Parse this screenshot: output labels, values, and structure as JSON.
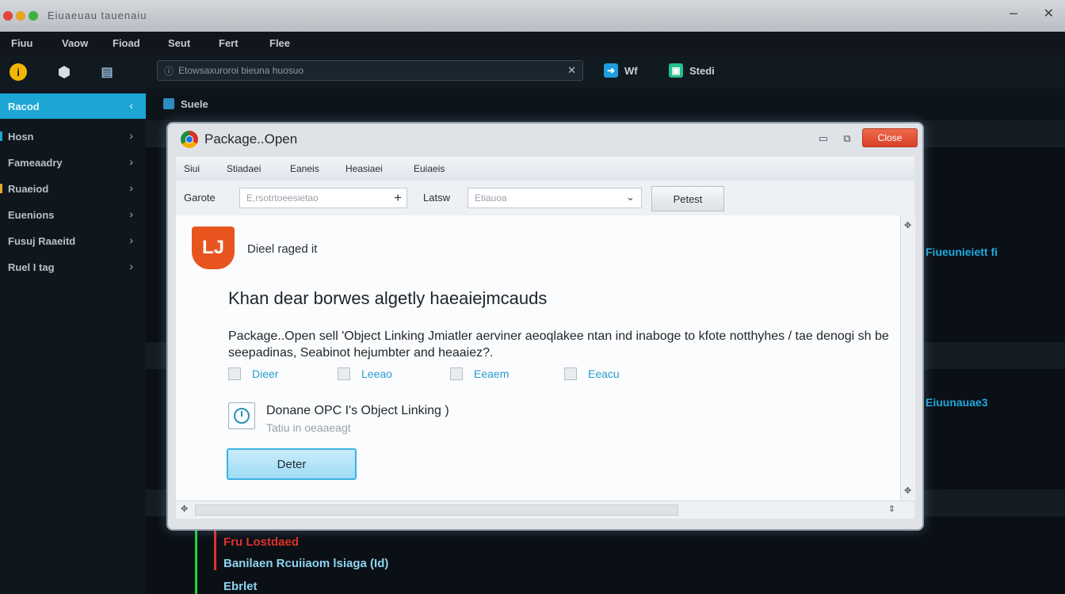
{
  "window": {
    "title": "Package..Open",
    "background_title": "Eiuaeuau tauenaiu",
    "close_label": "Close"
  },
  "background": {
    "menu": [
      "Fiuu",
      "Vaow",
      "Fioad",
      "Seut",
      "Fert",
      "Flee"
    ],
    "address": "Etowsaxuroroi bieuna huosuo",
    "toolbar_buttons": [
      "Wf",
      "Stedi"
    ],
    "content_header": "Suele",
    "sidebar": [
      "Racod",
      "Hosn",
      "Fameaadry",
      "Ruaeiod",
      "Euenions",
      "Fusuj Raaeitd",
      "Ruel I tag"
    ],
    "right_labels": [
      "Fiueunieiett fi",
      "Eiuunauae3"
    ],
    "tree": [
      "Fru Lostdaed",
      "Banilaen Rcuiiaom lsiaga (Id)",
      "Ebrlet"
    ]
  },
  "dialog": {
    "menu": [
      "Siui",
      "Stiadaei",
      "Eaneis",
      "Heasiaei",
      "Euiaeis"
    ],
    "search_label": "Garote",
    "search_placeholder": "E,rsotrtoeesietao",
    "view_label": "Latsw",
    "view_value": "Etiauoa",
    "action_button": "Petest",
    "package_name": "Dieel raged it",
    "heading": "Khan dear borwes algetly haeaiejmcauds",
    "paragraph": "Package..Open sell 'Object Linking Jmiatler aerviner aeoqlakee ntan ind inaboge to kfote notthyhes / tae denogi sh be seepadinas, Seabinot hejumbter and heaaiez?.",
    "options": [
      "Dieer",
      "Leeao",
      "Eeaem",
      "Eeacu"
    ],
    "selected_title": "Donane OPC I's Object Linking )",
    "selected_sub": "Tatiu in oeaaeagt",
    "primary_button": "Deter"
  },
  "colors": {
    "accent": "#1ba6d4",
    "close_red": "#e2492f",
    "package_orange": "#e8541e",
    "tree_green": "#1fd43c",
    "tree_red": "#e0312a"
  }
}
